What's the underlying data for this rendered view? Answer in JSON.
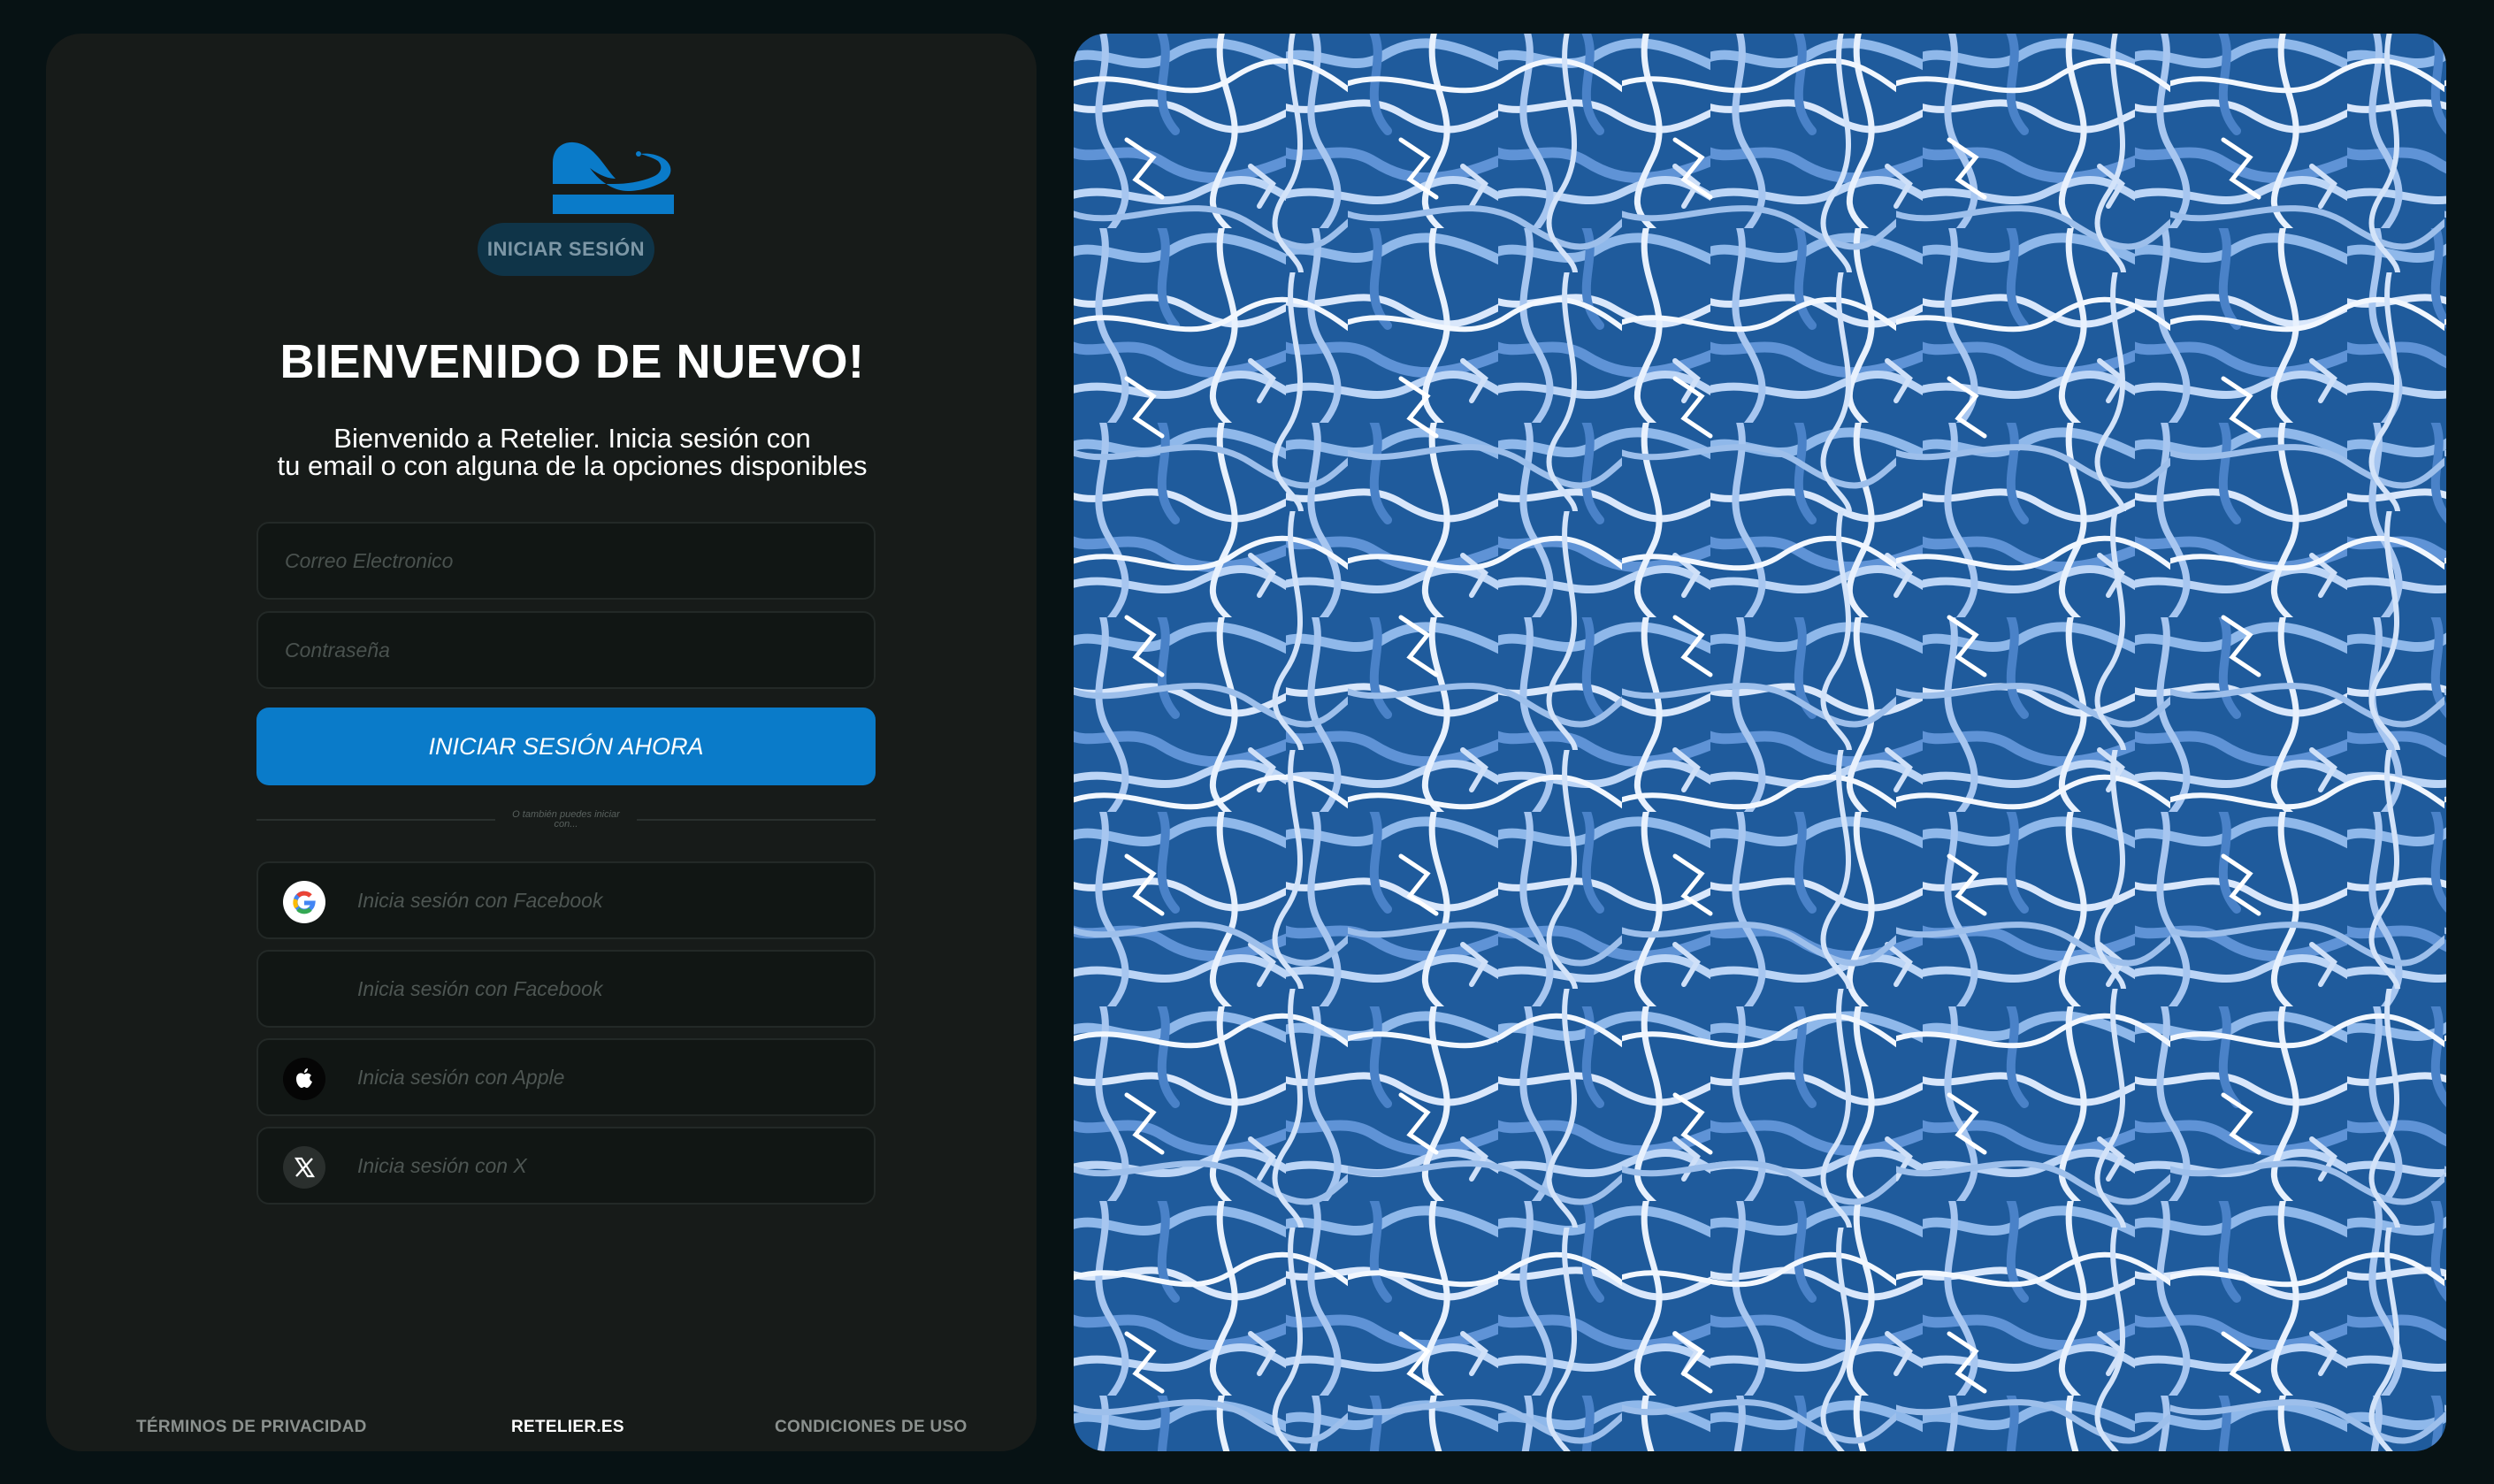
{
  "login_panel": {
    "badge_label": "INICIAR SESIÓN",
    "title": "BIENVENIDO DE NUEVO!",
    "subtitle_line1": "Bienvenido a Retelier. Inicia sesión con",
    "subtitle_line2": "tu email o con alguna de la opciones disponibles",
    "email_placeholder": "Correo Electronico",
    "password_placeholder": "Contraseña",
    "submit_label": "INICIAR SESIÓN AHORA",
    "divider_line1": "O también puedes iniciar",
    "divider_line2": "con...",
    "social_buttons": [
      {
        "icon": "google-icon",
        "label": "Inicia sesión con Facebook"
      },
      {
        "icon": "facebook-icon",
        "label": "Inicia sesión con Facebook"
      },
      {
        "icon": "apple-icon",
        "label": "Inicia sesión con Apple"
      },
      {
        "icon": "x-icon",
        "label": "Inicia sesión con X"
      }
    ]
  },
  "footer": {
    "privacy_label": "TÉRMINOS DE PRIVACIDAD",
    "site_label": "RETELIER.ES",
    "terms_label": "CONDICIONES DE USO"
  },
  "hero_image": {
    "description_icon": "shredded-paper-image"
  },
  "colors": {
    "background": "#071214",
    "panel": "#171b19",
    "accent": "#0a7bc9",
    "badge_bg": "#0f3448",
    "input_bg": "#111614"
  }
}
